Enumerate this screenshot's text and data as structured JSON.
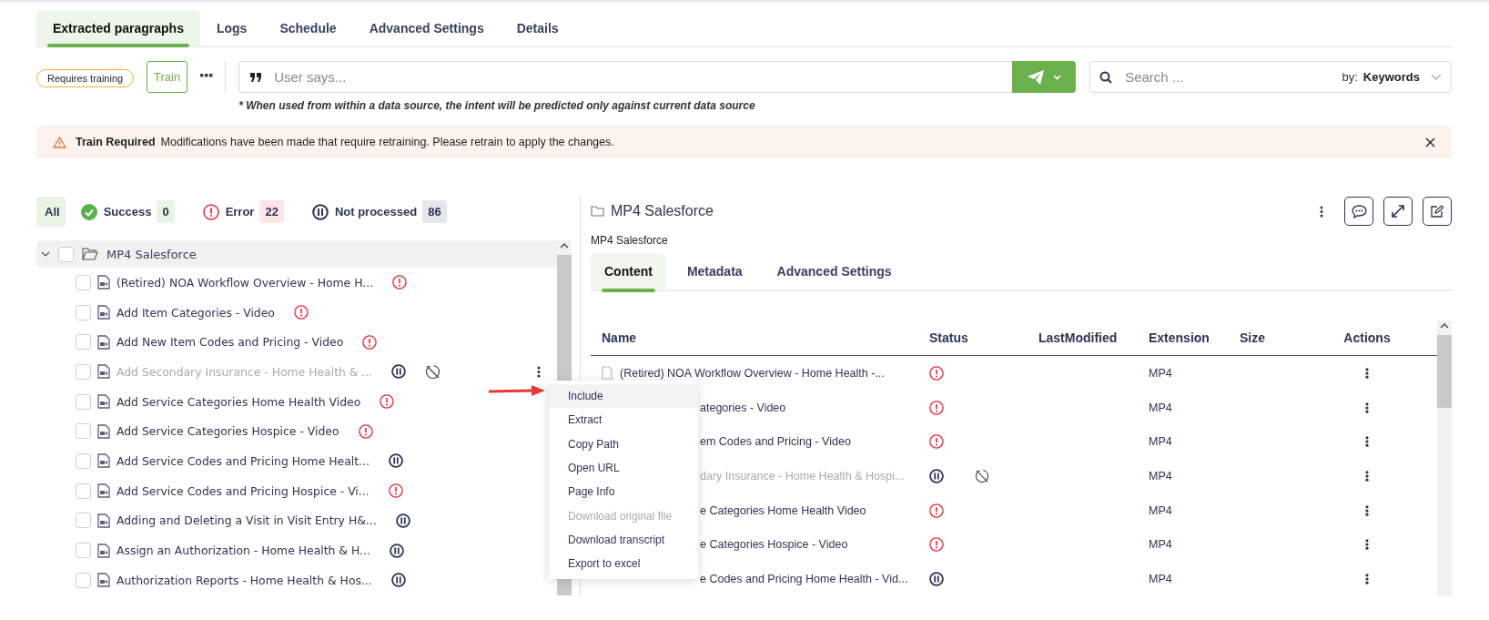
{
  "tabs": [
    {
      "label": "Extracted paragraphs",
      "selected": true
    },
    {
      "label": "Logs",
      "selected": false
    },
    {
      "label": "Schedule",
      "selected": false
    },
    {
      "label": "Advanced Settings",
      "selected": false
    },
    {
      "label": "Details",
      "selected": false
    }
  ],
  "toolbar": {
    "badge": "Requires training",
    "train_button": "Train",
    "query": {
      "placeholder": "User says..."
    },
    "note": "* When used from within a data source, the intent will be predicted only against current data source",
    "search": {
      "placeholder": "Search ...",
      "by_label": "by:",
      "by_value": "Keywords"
    }
  },
  "alert": {
    "title": "Train Required",
    "message": "Modifications have been made that require retraining. Please retrain to apply the changes."
  },
  "filters": [
    {
      "kind": "all",
      "label": "All",
      "selected": true
    },
    {
      "kind": "success",
      "label": "Success",
      "count": "0",
      "selected": false
    },
    {
      "kind": "error",
      "label": "Error",
      "count": "22",
      "selected": false
    },
    {
      "kind": "paused",
      "label": "Not processed",
      "count": "86",
      "selected": false
    }
  ],
  "tree": {
    "name": "MP4 Salesforce",
    "expanded": true,
    "checked": false,
    "children": [
      {
        "name": "(Retired) NOA Workflow Overview - Home H...",
        "kind": "error",
        "excluded": false,
        "checked": false,
        "menu_open": false
      },
      {
        "name": "Add Item Categories - Video",
        "kind": "error",
        "excluded": false,
        "checked": false,
        "menu_open": false
      },
      {
        "name": "Add New Item Codes and Pricing - Video",
        "kind": "error",
        "excluded": false,
        "checked": false,
        "menu_open": false
      },
      {
        "name": "Add Secondary Insurance - Home Health & ...",
        "kind": "paused",
        "excluded": true,
        "checked": false,
        "menu_open": true
      },
      {
        "name": "Add Service Categories Home Health Video",
        "kind": "error",
        "excluded": false,
        "checked": false,
        "menu_open": false
      },
      {
        "name": "Add Service Categories Hospice - Video",
        "kind": "error",
        "excluded": false,
        "checked": false,
        "menu_open": false
      },
      {
        "name": "Add Service Codes and Pricing Home Healt...",
        "kind": "paused",
        "excluded": false,
        "checked": false,
        "menu_open": false
      },
      {
        "name": "Add Service Codes and Pricing Hospice - Vi...",
        "kind": "error",
        "excluded": false,
        "checked": false,
        "menu_open": false
      },
      {
        "name": "Adding and Deleting a Visit in Visit Entry H&...",
        "kind": "paused",
        "excluded": false,
        "checked": false,
        "menu_open": false
      },
      {
        "name": "Assign an Authorization - Home Health & H...",
        "kind": "paused",
        "excluded": false,
        "checked": false,
        "menu_open": false
      },
      {
        "name": "Authorization Reports - Home Health & Hos...",
        "kind": "paused",
        "excluded": false,
        "checked": false,
        "menu_open": false
      }
    ]
  },
  "context_menu": {
    "items": [
      {
        "label": "Include",
        "highlighted": true,
        "disabled": false
      },
      {
        "label": "Extract",
        "highlighted": false,
        "disabled": false
      },
      {
        "label": "Copy Path",
        "highlighted": false,
        "disabled": false
      },
      {
        "label": "Open URL",
        "highlighted": false,
        "disabled": false
      },
      {
        "label": "Page Info",
        "highlighted": false,
        "disabled": false
      },
      {
        "label": "Download original file",
        "highlighted": false,
        "disabled": true
      },
      {
        "label": "Download transcript",
        "highlighted": false,
        "disabled": false
      },
      {
        "label": "Export to excel",
        "highlighted": false,
        "disabled": false
      }
    ]
  },
  "detail": {
    "title": "MP4 Salesforce",
    "subtitle": "MP4 Salesforce",
    "tabs": [
      {
        "label": "Content",
        "selected": true
      },
      {
        "label": "Metadata",
        "selected": false
      },
      {
        "label": "Advanced Settings",
        "selected": false
      }
    ],
    "columns": [
      "Name",
      "Status",
      "LastModified",
      "Extension",
      "Size",
      "Actions"
    ],
    "rows": [
      {
        "name": "(Retired) NOA Workflow Overview - Home Health -...",
        "covered": false,
        "kind": "error",
        "excluded": false,
        "extension": "MP4"
      },
      {
        "name": "ategories - Video",
        "covered": true,
        "kind": "error",
        "excluded": false,
        "extension": "MP4"
      },
      {
        "name": "em Codes and Pricing - Video",
        "covered": true,
        "kind": "error",
        "excluded": false,
        "extension": "MP4"
      },
      {
        "name": "dary Insurance - Home Health & Hospi...",
        "covered": true,
        "kind": "paused",
        "excluded": true,
        "extension": "MP4"
      },
      {
        "name": "e Categories Home Health Video",
        "covered": true,
        "kind": "error",
        "excluded": false,
        "extension": "MP4"
      },
      {
        "name": "e Categories Hospice - Video",
        "covered": true,
        "kind": "error",
        "excluded": false,
        "extension": "MP4"
      },
      {
        "name": "e Codes and Pricing Home Health - Vid...",
        "covered": true,
        "kind": "paused",
        "excluded": false,
        "extension": "MP4"
      }
    ]
  }
}
